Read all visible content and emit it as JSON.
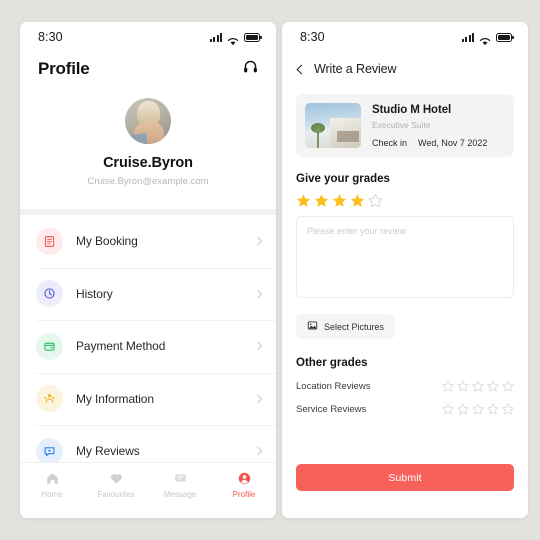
{
  "theme": {
    "background": "#e2e2de",
    "accent": "#f8615a",
    "star_filled": "#fdbe1e",
    "star_empty": "#d8d8d8"
  },
  "left_phone": {
    "status_bar": {
      "time": "8:30",
      "icons": [
        "signal-icon",
        "wifi-icon",
        "battery-icon"
      ]
    },
    "header": {
      "title": "Profile",
      "support_icon": "headphones-icon"
    },
    "profile": {
      "avatar_icon": "user-avatar",
      "name": "Cruise.Byron",
      "email": "Cruise.Byron@example.com"
    },
    "menu": [
      {
        "label": "My Booking",
        "icon": "booking-icon",
        "color": "#f2635d",
        "bg": "#fdeceb"
      },
      {
        "label": "History",
        "icon": "clock-icon",
        "color": "#5b5bd6",
        "bg": "#ececfb"
      },
      {
        "label": "Payment Method",
        "icon": "wallet-icon",
        "color": "#32c06c",
        "bg": "#e6f8ee"
      },
      {
        "label": "My Information",
        "icon": "person-icon",
        "color": "#f5b727",
        "bg": "#fdf4e0"
      },
      {
        "label": "My Reviews",
        "icon": "chat-icon",
        "color": "#2f80ed",
        "bg": "#e6f0fd"
      }
    ],
    "tabs": [
      {
        "label": "Home",
        "icon": "home-icon",
        "active": false
      },
      {
        "label": "Favourites",
        "icon": "heart-icon",
        "active": false
      },
      {
        "label": "Message",
        "icon": "message-icon",
        "active": false
      },
      {
        "label": "Profile",
        "icon": "profile-icon",
        "active": true
      }
    ]
  },
  "right_phone": {
    "status_bar": {
      "time": "8:30",
      "icons": [
        "signal-icon",
        "wifi-icon",
        "battery-icon"
      ]
    },
    "navbar": {
      "back_icon": "chevron-left-icon",
      "title": "Write a Review"
    },
    "hotel": {
      "image": "hotel-thumbnail",
      "name": "Studio M Hotel",
      "room": "Executive Suite",
      "checkin_label": "Check in",
      "checkin_date": "Wed, Nov 7 2022"
    },
    "grades": {
      "title": "Give your grades",
      "rating": 4,
      "max": 5
    },
    "review": {
      "placeholder": "Please enter your review",
      "value": ""
    },
    "pick_pictures": {
      "label": "Select Pictures",
      "icon": "image-icon"
    },
    "other_grades": {
      "title": "Other grades",
      "rows": [
        {
          "label": "Location Reviews",
          "rating": 0,
          "max": 5
        },
        {
          "label": "Service Reviews",
          "rating": 0,
          "max": 5
        }
      ]
    },
    "submit": {
      "label": "Submit"
    }
  }
}
